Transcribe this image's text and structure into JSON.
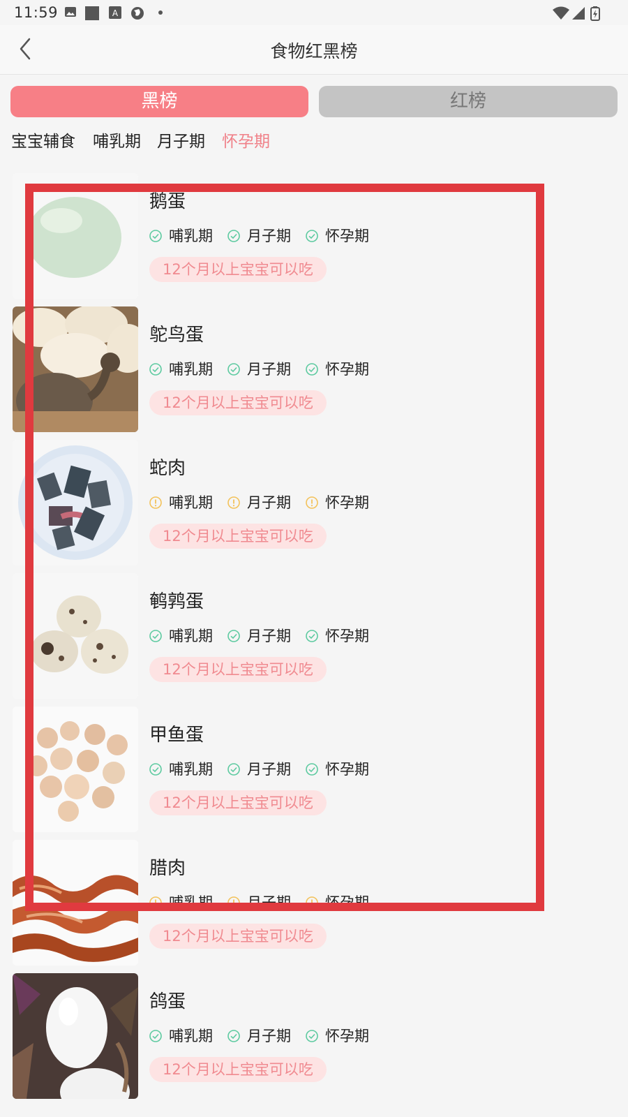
{
  "status_bar": {
    "time": "11:59"
  },
  "header": {
    "title": "食物红黑榜"
  },
  "tabs": {
    "black_label": "黑榜",
    "red_label": "红榜",
    "active": "黑榜"
  },
  "categories": [
    "宝宝辅食",
    "哺乳期",
    "月子期",
    "怀孕期"
  ],
  "active_category": "怀孕期",
  "colors": {
    "accent": "#f77f86",
    "ok": "#5dcaa0",
    "warn": "#f3c25a",
    "age_bg": "#fde3e3",
    "overlay": "#e03a3f"
  },
  "foods": [
    {
      "name": "鹅蛋",
      "tags": [
        {
          "label": "哺乳期",
          "status": "ok"
        },
        {
          "label": "月子期",
          "status": "ok"
        },
        {
          "label": "怀孕期",
          "status": "ok"
        }
      ],
      "age": "12个月以上宝宝可以吃",
      "image": "goose-egg"
    },
    {
      "name": "鸵鸟蛋",
      "tags": [
        {
          "label": "哺乳期",
          "status": "ok"
        },
        {
          "label": "月子期",
          "status": "ok"
        },
        {
          "label": "怀孕期",
          "status": "ok"
        }
      ],
      "age": "12个月以上宝宝可以吃",
      "image": "ostrich-egg"
    },
    {
      "name": "蛇肉",
      "tags": [
        {
          "label": "哺乳期",
          "status": "warn"
        },
        {
          "label": "月子期",
          "status": "warn"
        },
        {
          "label": "怀孕期",
          "status": "warn"
        }
      ],
      "age": "12个月以上宝宝可以吃",
      "image": "snake-meat"
    },
    {
      "name": "鹌鹑蛋",
      "tags": [
        {
          "label": "哺乳期",
          "status": "ok"
        },
        {
          "label": "月子期",
          "status": "ok"
        },
        {
          "label": "怀孕期",
          "status": "ok"
        }
      ],
      "age": "12个月以上宝宝可以吃",
      "image": "quail-egg"
    },
    {
      "name": "甲鱼蛋",
      "tags": [
        {
          "label": "哺乳期",
          "status": "ok"
        },
        {
          "label": "月子期",
          "status": "ok"
        },
        {
          "label": "怀孕期",
          "status": "ok"
        }
      ],
      "age": "12个月以上宝宝可以吃",
      "image": "turtle-egg"
    },
    {
      "name": "腊肉",
      "tags": [
        {
          "label": "哺乳期",
          "status": "warn"
        },
        {
          "label": "月子期",
          "status": "warn"
        },
        {
          "label": "怀孕期",
          "status": "warn"
        }
      ],
      "age": "12个月以上宝宝可以吃",
      "image": "cured-meat"
    },
    {
      "name": "鸽蛋",
      "tags": [
        {
          "label": "哺乳期",
          "status": "ok"
        },
        {
          "label": "月子期",
          "status": "ok"
        },
        {
          "label": "怀孕期",
          "status": "ok"
        }
      ],
      "age": "12个月以上宝宝可以吃",
      "image": "pigeon-egg"
    }
  ]
}
